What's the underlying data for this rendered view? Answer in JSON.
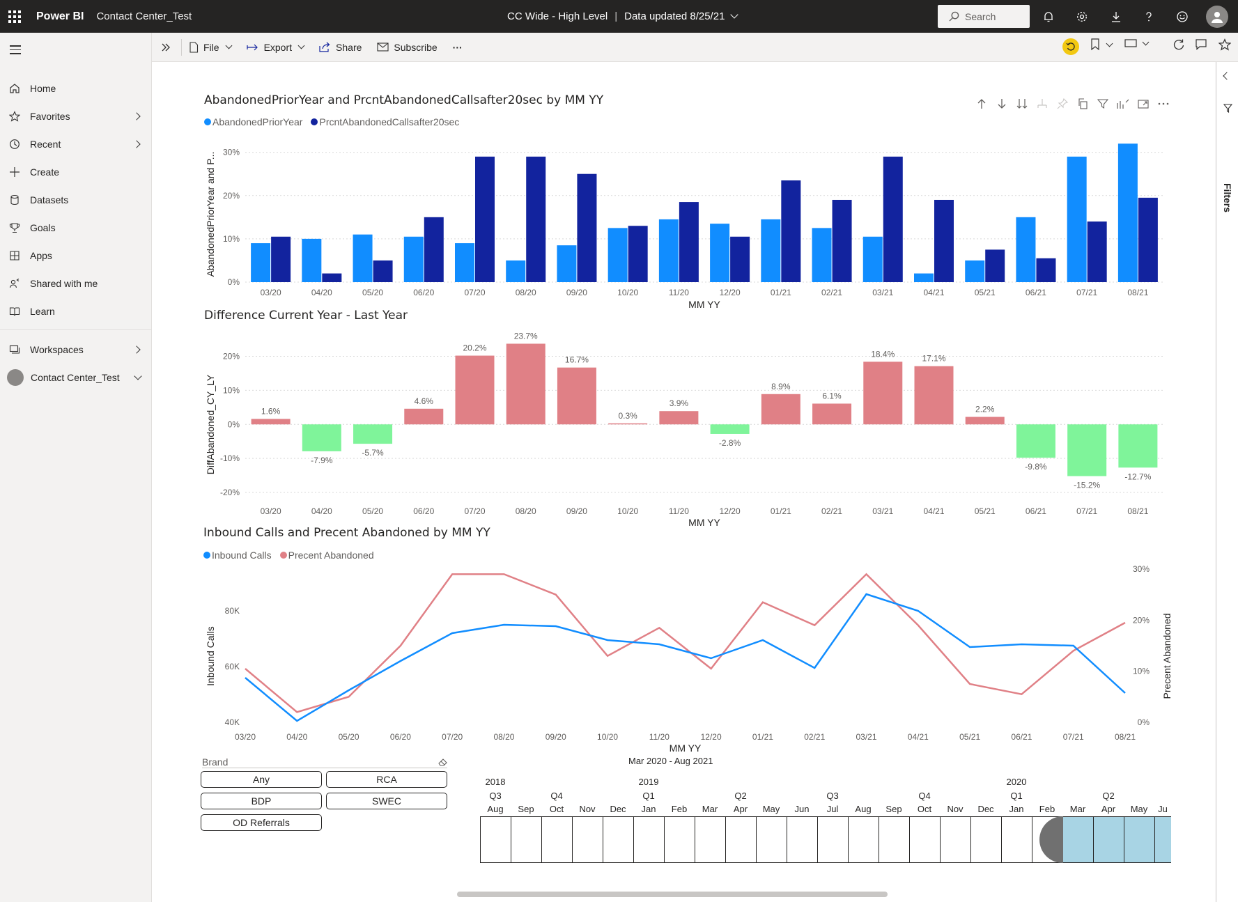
{
  "app": {
    "brand": "Power BI",
    "workspace": "Contact Center_Test",
    "report_title": "CC Wide - High Level",
    "data_updated": "Data updated 8/25/21",
    "search_placeholder": "Search"
  },
  "nav": {
    "items": [
      {
        "label": "Home",
        "icon": "home-icon"
      },
      {
        "label": "Favorites",
        "icon": "star-icon"
      },
      {
        "label": "Recent",
        "icon": "clock-icon"
      },
      {
        "label": "Create",
        "icon": "plus-icon"
      },
      {
        "label": "Datasets",
        "icon": "database-icon"
      },
      {
        "label": "Goals",
        "icon": "trophy-icon"
      },
      {
        "label": "Apps",
        "icon": "apps-icon"
      },
      {
        "label": "Shared with me",
        "icon": "shared-icon"
      },
      {
        "label": "Learn",
        "icon": "book-icon"
      },
      {
        "label": "Workspaces",
        "icon": "workspaces-icon"
      },
      {
        "label": "Contact Center_Test",
        "icon": "workspace-avatar"
      }
    ]
  },
  "actionbar": {
    "file": "File",
    "export": "Export",
    "share": "Share",
    "subscribe": "Subscribe",
    "more": "···"
  },
  "filters_pane": {
    "label": "Filters"
  },
  "colors": {
    "light_blue": "#118dff",
    "dark_blue": "#12239e",
    "positive_red": "#e08086",
    "negative_green": "#7ff49a",
    "inbound_blue": "#118dff",
    "abandoned_pink": "#e08086"
  },
  "chart_data": [
    {
      "type": "bar",
      "title": "AbandonedPriorYear and PrcntAbandonedCallsafter20sec by MM YY",
      "xlabel": "MM YY",
      "ylabel": "AbandonedPriorYear and P...",
      "categories": [
        "03/20",
        "04/20",
        "05/20",
        "06/20",
        "07/20",
        "08/20",
        "09/20",
        "10/20",
        "11/20",
        "12/20",
        "01/21",
        "02/21",
        "03/21",
        "04/21",
        "05/21",
        "06/21",
        "07/21",
        "08/21"
      ],
      "series": [
        {
          "name": "AbandonedPriorYear",
          "values": [
            9,
            10,
            11,
            10.5,
            9,
            5,
            8.5,
            12.5,
            14.5,
            13.5,
            14.5,
            12.5,
            10.5,
            2,
            5,
            15,
            29,
            32
          ]
        },
        {
          "name": "PrcntAbandonedCallsafter20sec",
          "values": [
            10.5,
            2,
            5,
            15,
            29,
            29,
            25,
            13,
            18.5,
            10.5,
            23.5,
            19,
            29,
            19,
            7.5,
            5.5,
            14,
            19.5
          ]
        }
      ],
      "yticks": [
        "0%",
        "10%",
        "20%",
        "30%"
      ],
      "ylim": [
        0,
        33
      ],
      "grid": true
    },
    {
      "type": "bar",
      "title": "Difference Current Year - Last Year",
      "xlabel": "MM YY",
      "ylabel": "DiffAbandoned_CY_LY",
      "categories": [
        "03/20",
        "04/20",
        "05/20",
        "06/20",
        "07/20",
        "08/20",
        "09/20",
        "10/20",
        "11/20",
        "12/20",
        "01/21",
        "02/21",
        "03/21",
        "04/21",
        "05/21",
        "06/21",
        "07/21",
        "08/21"
      ],
      "values": [
        1.6,
        -7.9,
        -5.7,
        4.6,
        20.2,
        23.7,
        16.7,
        0.3,
        3.9,
        -2.8,
        8.9,
        6.1,
        18.4,
        17.1,
        2.2,
        -9.8,
        -15.2,
        -12.7
      ],
      "labels": [
        "1.6%",
        "-7.9%",
        "-5.7%",
        "4.6%",
        "20.2%",
        "23.7%",
        "16.7%",
        "0.3%",
        "3.9%",
        "-2.8%",
        "8.9%",
        "6.1%",
        "18.4%",
        "17.1%",
        "2.2%",
        "-9.8%",
        "-15.2%",
        "-12.7%"
      ],
      "yticks": [
        "-20%",
        "-10%",
        "0%",
        "10%",
        "20%"
      ],
      "ylim": [
        -20,
        24
      ],
      "grid": true
    },
    {
      "type": "line",
      "title": "Inbound Calls and Precent Abandoned by MM YY",
      "xlabel": "MM YY",
      "ylabel": "Inbound Calls",
      "y2label": "Precent Abandoned",
      "categories": [
        "03/20",
        "04/20",
        "05/20",
        "06/20",
        "07/20",
        "08/20",
        "09/20",
        "10/20",
        "11/20",
        "12/20",
        "01/21",
        "02/21",
        "03/21",
        "04/21",
        "05/21",
        "06/21",
        "07/21",
        "08/21"
      ],
      "series": [
        {
          "name": "Inbound Calls",
          "axis": "left",
          "values": [
            56000,
            40500,
            51500,
            62000,
            72000,
            75000,
            74500,
            69500,
            68000,
            63000,
            69500,
            59500,
            86000,
            80000,
            67000,
            68000,
            67500,
            50500
          ]
        },
        {
          "name": "Precent Abandoned",
          "axis": "right",
          "values": [
            10.5,
            2,
            5,
            15,
            29,
            29,
            25,
            13,
            18.5,
            10.5,
            23.5,
            19,
            29,
            19,
            7.5,
            5.5,
            14,
            19.5
          ]
        }
      ],
      "yticks": [
        "40K",
        "60K",
        "80K"
      ],
      "y2ticks": [
        "0%",
        "10%",
        "20%",
        "30%"
      ],
      "ylim": [
        40000,
        95000
      ],
      "y2lim": [
        0,
        30
      ]
    }
  ],
  "slicer": {
    "title": "Brand",
    "options": [
      "Any",
      "RCA",
      "BDP",
      "SWEC",
      "OD Referrals"
    ]
  },
  "timeline": {
    "range": "Mar 2020 - Aug 2021",
    "years": [
      "2018",
      "2019",
      "2020"
    ],
    "quarters": [
      "Q3",
      "Q4",
      "Q1",
      "Q2",
      "Q3",
      "Q4",
      "Q1",
      "Q2"
    ],
    "months": [
      "Aug",
      "Sep",
      "Oct",
      "Nov",
      "Dec",
      "Jan",
      "Feb",
      "Mar",
      "Apr",
      "May",
      "Jun",
      "Jul",
      "Aug",
      "Sep",
      "Oct",
      "Nov",
      "Dec",
      "Jan",
      "Feb",
      "Mar",
      "Apr",
      "May",
      "Ju"
    ],
    "selected_from_index": 19
  }
}
